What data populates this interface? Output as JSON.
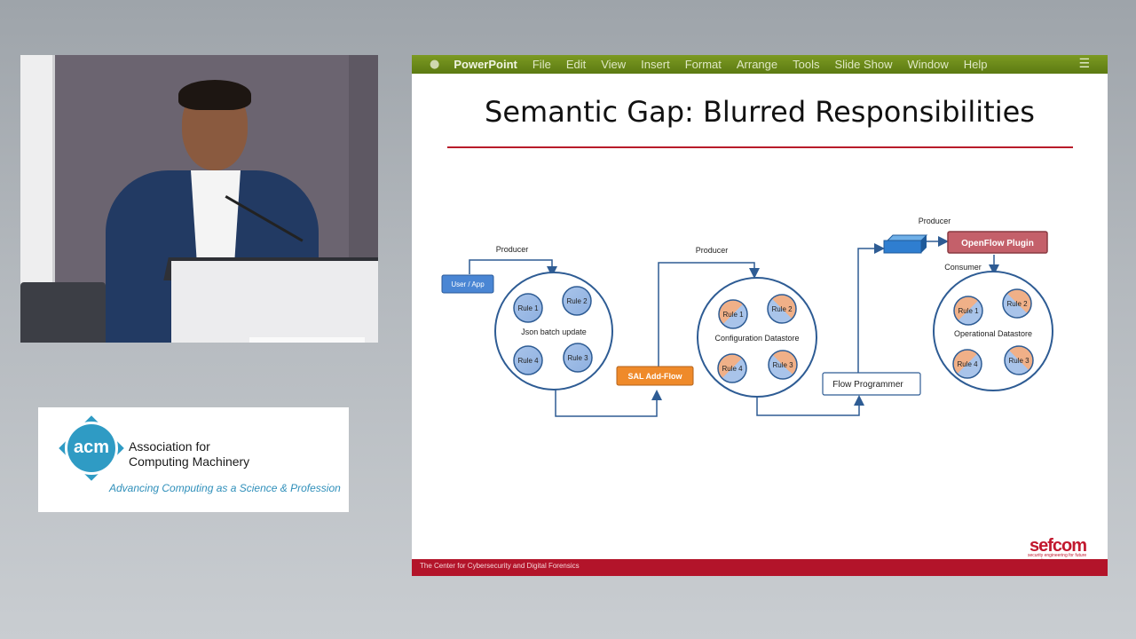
{
  "menu": {
    "app_name": "PowerPoint",
    "items": [
      "File",
      "Edit",
      "View",
      "Insert",
      "Format",
      "Arrange",
      "Tools",
      "Slide Show",
      "Window",
      "Help"
    ]
  },
  "slide": {
    "title": "Semantic Gap: Blurred Responsibilities",
    "footer": "The Center for Cybersecurity and Digital Forensics",
    "brand": "sefcom",
    "brand_tagline": "security engineering for future computing"
  },
  "diagram": {
    "user_app": "User / App",
    "producer_label": "Producer",
    "consumer_label": "Consumer",
    "json_batch": "Json batch update",
    "sal_add_flow": "SAL Add-Flow",
    "config_datastore": "Configuration Datastore",
    "flow_programmer": "Flow Programmer",
    "openflow_plugin": "OpenFlow Plugin",
    "operational_datastore": "Operational Datastore",
    "rules": [
      "Rule 1",
      "Rule 2",
      "Rule 3",
      "Rule 4"
    ]
  },
  "acm": {
    "logo": "acm",
    "name_line1": "Association for",
    "name_line2": "Computing Machinery",
    "tagline": "Advancing Computing as a Science & Profession"
  },
  "colors": {
    "menubar": "#6b8a1a",
    "title_rule": "#b81c2a",
    "footer_bar": "#b3142a",
    "user_app_box": "#4a86d4",
    "sal_box": "#ef8a2a",
    "openflow_box": "#c4606a",
    "connector": "#2e5c94"
  }
}
